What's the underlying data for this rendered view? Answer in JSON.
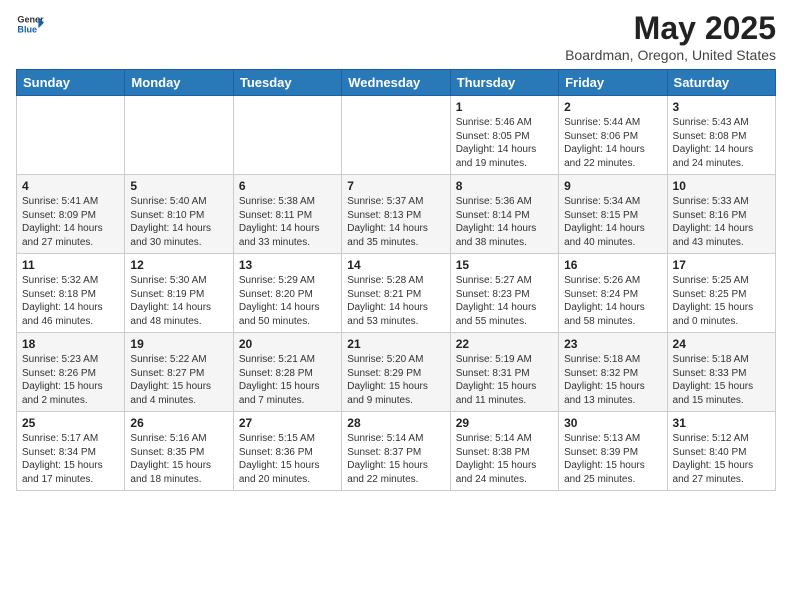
{
  "logo": {
    "general": "General",
    "blue": "Blue"
  },
  "title": "May 2025",
  "subtitle": "Boardman, Oregon, United States",
  "days_of_week": [
    "Sunday",
    "Monday",
    "Tuesday",
    "Wednesday",
    "Thursday",
    "Friday",
    "Saturday"
  ],
  "weeks": [
    [
      {
        "day": "",
        "sunrise": "",
        "sunset": "",
        "daylight": ""
      },
      {
        "day": "",
        "sunrise": "",
        "sunset": "",
        "daylight": ""
      },
      {
        "day": "",
        "sunrise": "",
        "sunset": "",
        "daylight": ""
      },
      {
        "day": "",
        "sunrise": "",
        "sunset": "",
        "daylight": ""
      },
      {
        "day": "1",
        "sunrise": "Sunrise: 5:46 AM",
        "sunset": "Sunset: 8:05 PM",
        "daylight": "Daylight: 14 hours and 19 minutes."
      },
      {
        "day": "2",
        "sunrise": "Sunrise: 5:44 AM",
        "sunset": "Sunset: 8:06 PM",
        "daylight": "Daylight: 14 hours and 22 minutes."
      },
      {
        "day": "3",
        "sunrise": "Sunrise: 5:43 AM",
        "sunset": "Sunset: 8:08 PM",
        "daylight": "Daylight: 14 hours and 24 minutes."
      }
    ],
    [
      {
        "day": "4",
        "sunrise": "Sunrise: 5:41 AM",
        "sunset": "Sunset: 8:09 PM",
        "daylight": "Daylight: 14 hours and 27 minutes."
      },
      {
        "day": "5",
        "sunrise": "Sunrise: 5:40 AM",
        "sunset": "Sunset: 8:10 PM",
        "daylight": "Daylight: 14 hours and 30 minutes."
      },
      {
        "day": "6",
        "sunrise": "Sunrise: 5:38 AM",
        "sunset": "Sunset: 8:11 PM",
        "daylight": "Daylight: 14 hours and 33 minutes."
      },
      {
        "day": "7",
        "sunrise": "Sunrise: 5:37 AM",
        "sunset": "Sunset: 8:13 PM",
        "daylight": "Daylight: 14 hours and 35 minutes."
      },
      {
        "day": "8",
        "sunrise": "Sunrise: 5:36 AM",
        "sunset": "Sunset: 8:14 PM",
        "daylight": "Daylight: 14 hours and 38 minutes."
      },
      {
        "day": "9",
        "sunrise": "Sunrise: 5:34 AM",
        "sunset": "Sunset: 8:15 PM",
        "daylight": "Daylight: 14 hours and 40 minutes."
      },
      {
        "day": "10",
        "sunrise": "Sunrise: 5:33 AM",
        "sunset": "Sunset: 8:16 PM",
        "daylight": "Daylight: 14 hours and 43 minutes."
      }
    ],
    [
      {
        "day": "11",
        "sunrise": "Sunrise: 5:32 AM",
        "sunset": "Sunset: 8:18 PM",
        "daylight": "Daylight: 14 hours and 46 minutes."
      },
      {
        "day": "12",
        "sunrise": "Sunrise: 5:30 AM",
        "sunset": "Sunset: 8:19 PM",
        "daylight": "Daylight: 14 hours and 48 minutes."
      },
      {
        "day": "13",
        "sunrise": "Sunrise: 5:29 AM",
        "sunset": "Sunset: 8:20 PM",
        "daylight": "Daylight: 14 hours and 50 minutes."
      },
      {
        "day": "14",
        "sunrise": "Sunrise: 5:28 AM",
        "sunset": "Sunset: 8:21 PM",
        "daylight": "Daylight: 14 hours and 53 minutes."
      },
      {
        "day": "15",
        "sunrise": "Sunrise: 5:27 AM",
        "sunset": "Sunset: 8:23 PM",
        "daylight": "Daylight: 14 hours and 55 minutes."
      },
      {
        "day": "16",
        "sunrise": "Sunrise: 5:26 AM",
        "sunset": "Sunset: 8:24 PM",
        "daylight": "Daylight: 14 hours and 58 minutes."
      },
      {
        "day": "17",
        "sunrise": "Sunrise: 5:25 AM",
        "sunset": "Sunset: 8:25 PM",
        "daylight": "Daylight: 15 hours and 0 minutes."
      }
    ],
    [
      {
        "day": "18",
        "sunrise": "Sunrise: 5:23 AM",
        "sunset": "Sunset: 8:26 PM",
        "daylight": "Daylight: 15 hours and 2 minutes."
      },
      {
        "day": "19",
        "sunrise": "Sunrise: 5:22 AM",
        "sunset": "Sunset: 8:27 PM",
        "daylight": "Daylight: 15 hours and 4 minutes."
      },
      {
        "day": "20",
        "sunrise": "Sunrise: 5:21 AM",
        "sunset": "Sunset: 8:28 PM",
        "daylight": "Daylight: 15 hours and 7 minutes."
      },
      {
        "day": "21",
        "sunrise": "Sunrise: 5:20 AM",
        "sunset": "Sunset: 8:29 PM",
        "daylight": "Daylight: 15 hours and 9 minutes."
      },
      {
        "day": "22",
        "sunrise": "Sunrise: 5:19 AM",
        "sunset": "Sunset: 8:31 PM",
        "daylight": "Daylight: 15 hours and 11 minutes."
      },
      {
        "day": "23",
        "sunrise": "Sunrise: 5:18 AM",
        "sunset": "Sunset: 8:32 PM",
        "daylight": "Daylight: 15 hours and 13 minutes."
      },
      {
        "day": "24",
        "sunrise": "Sunrise: 5:18 AM",
        "sunset": "Sunset: 8:33 PM",
        "daylight": "Daylight: 15 hours and 15 minutes."
      }
    ],
    [
      {
        "day": "25",
        "sunrise": "Sunrise: 5:17 AM",
        "sunset": "Sunset: 8:34 PM",
        "daylight": "Daylight: 15 hours and 17 minutes."
      },
      {
        "day": "26",
        "sunrise": "Sunrise: 5:16 AM",
        "sunset": "Sunset: 8:35 PM",
        "daylight": "Daylight: 15 hours and 18 minutes."
      },
      {
        "day": "27",
        "sunrise": "Sunrise: 5:15 AM",
        "sunset": "Sunset: 8:36 PM",
        "daylight": "Daylight: 15 hours and 20 minutes."
      },
      {
        "day": "28",
        "sunrise": "Sunrise: 5:14 AM",
        "sunset": "Sunset: 8:37 PM",
        "daylight": "Daylight: 15 hours and 22 minutes."
      },
      {
        "day": "29",
        "sunrise": "Sunrise: 5:14 AM",
        "sunset": "Sunset: 8:38 PM",
        "daylight": "Daylight: 15 hours and 24 minutes."
      },
      {
        "day": "30",
        "sunrise": "Sunrise: 5:13 AM",
        "sunset": "Sunset: 8:39 PM",
        "daylight": "Daylight: 15 hours and 25 minutes."
      },
      {
        "day": "31",
        "sunrise": "Sunrise: 5:12 AM",
        "sunset": "Sunset: 8:40 PM",
        "daylight": "Daylight: 15 hours and 27 minutes."
      }
    ]
  ]
}
